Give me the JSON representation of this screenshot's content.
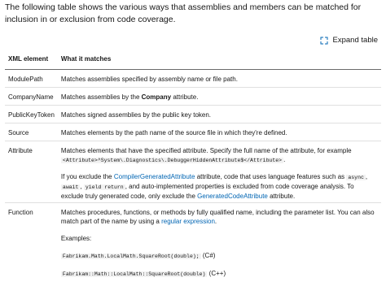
{
  "intro": "The following table shows the various ways that assemblies and members can be matched for inclusion in or exclusion from code coverage.",
  "expand_label": "Expand table",
  "table": {
    "headers": [
      "XML element",
      "What it matches"
    ],
    "rows": {
      "modulepath": {
        "element": "ModulePath",
        "text": "Matches assemblies specified by assembly name or file path."
      },
      "companyname": {
        "element": "CompanyName",
        "pre": "Matches assemblies by the ",
        "bold": "Company",
        "post": " attribute."
      },
      "publickeytoken": {
        "element": "PublicKeyToken",
        "text": "Matches signed assemblies by the public key token."
      },
      "source": {
        "element": "Source",
        "text": "Matches elements by the path name of the source file in which they're defined."
      },
      "attribute": {
        "element": "Attribute",
        "p1": "Matches elements that have the specified attribute. Specify the full name of the attribute, for example",
        "code1": "<Attribute>^System\\.Diagnostics\\.DebuggerHiddenAttribute$</Attribute>",
        "p1_end": ".",
        "p2_a": "If you exclude the ",
        "link1": "CompilerGeneratedAttribute",
        "p2_b": " attribute, code that uses language features such as ",
        "code_async": "async",
        "p2_c": ", ",
        "code_await": "await",
        "p2_d": ", ",
        "code_yield": "yield return",
        "p2_e": ", and auto-implemented properties is excluded from code coverage analysis. To exclude truly generated code, only exclude the ",
        "link2": "GeneratedCodeAttribute",
        "p2_f": " attribute."
      },
      "function": {
        "element": "Function",
        "p1_a": "Matches procedures, functions, or methods by fully qualified name, including the parameter list. You can also match part of the name by using a ",
        "link": "regular expression",
        "p1_b": ".",
        "examples_label": "Examples:",
        "ex1_code": "Fabrikam.Math.LocalMath.SquareRoot(double);",
        "ex1_lang": " (C#)",
        "ex2_code": "Fabrikam::Math::LocalMath::SquareRoot(double)",
        "ex2_lang": " (C++)"
      }
    }
  },
  "colors": {
    "link": "#0065b3",
    "code_bg": "#f2f2f2",
    "header_border": "#6b6b6b",
    "row_border": "#e0e0e0"
  },
  "icons": {
    "expand": "expand-arrows-icon"
  }
}
